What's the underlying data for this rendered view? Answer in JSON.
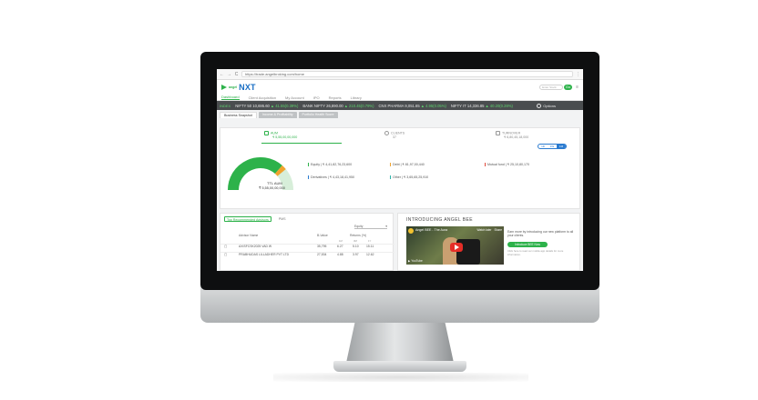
{
  "browser": {
    "url": "https://trade.angelbroking.com/home",
    "back": "←",
    "forward": "→",
    "reload": "C",
    "menu": "⋮"
  },
  "header": {
    "logo_small": "angel",
    "logo_main": "NXT",
    "search_placeholder": "Enter Stock",
    "go": "Go",
    "menu_icon": "≡"
  },
  "nav": {
    "items": [
      "Dashboard",
      "Client Acquisition",
      "My Account",
      "IPO",
      "Reports",
      "Library"
    ]
  },
  "ticker": {
    "category": "INDEX",
    "items": [
      {
        "name": "NIFTY 50",
        "value": "10,695.60",
        "change": "▲ 41.55(0.39%)"
      },
      {
        "name": "BANK NIFTY",
        "value": "26,890.00",
        "change": "▲ 210.45(0.79%)"
      },
      {
        "name": "CNX PHARMA",
        "value": "9,051.65",
        "change": "▲ 4.95(0.05%)"
      },
      {
        "name": "NIFTY IT",
        "value": "14,336.85",
        "change": "▲ 40.20(0.28%)"
      }
    ],
    "settings": "Options"
  },
  "tabs": [
    "Business Snapshot",
    "Income & Profitability",
    "Portfolio Health Score"
  ],
  "panel": {
    "subtabs": [
      {
        "title": "AUM",
        "sub": "₹ 5,55,00,00,000"
      },
      {
        "title": "CLIENTS",
        "sub": "37"
      },
      {
        "title": "TURNOVER",
        "sub": "₹ 6,80,45,18,000"
      }
    ],
    "toggle": [
      "1D",
      "1W",
      "1M"
    ],
    "toggle_active": "1M",
    "gauge_label": "TTL AUM",
    "gauge_value": "₹ 5,55,00,00,000",
    "gauge_fraction": 0.78,
    "metrics": [
      {
        "text": "Equity | ₹ 4,41,82,76,23,600",
        "color": "green"
      },
      {
        "text": "Debt | ₹ 81,97,00,440",
        "color": "orange"
      },
      {
        "text": "Mutual fund | ₹ 25,10,80,170",
        "color": "red"
      },
      {
        "text": "Derivatives | ₹ 4,43,18,41,950",
        "color": "blue"
      },
      {
        "text": "Other | ₹ 3,65,65,25,910",
        "color": "teal"
      }
    ]
  },
  "recommend": {
    "tabs": [
      "Top Recommended Advisors",
      "PMS"
    ],
    "active_tab": "Top Recommended Advisors",
    "select": "Equity",
    "columns": [
      "Advisor Name",
      "B-Value",
      "Returns (%)"
    ],
    "subcolumns": [
      "1M",
      "3M",
      "1Y"
    ],
    "rows": [
      {
        "name": "AXISFCSK2025 VAD W",
        "value": "35,795",
        "r1": "6.27",
        "r2": "5.10",
        "r3": "15.11"
      },
      {
        "name": "PRABHUDAS LILLADHER PVT LTD",
        "value": "27,534",
        "r1": "4.88",
        "r2": "3.97",
        "r3": "12.62"
      }
    ]
  },
  "promo": {
    "title": "INTRODUCING ANGEL BEE",
    "video_title": "Angel BEE - The Aura",
    "video_watch": "Watch later",
    "video_share": "Share",
    "video_brand": "▶ YouTube",
    "text": "Earn more by introducing our new platform to all your clients.",
    "button": "Introduce BEE Now",
    "note": "Click here to read our mobile app details for more information."
  },
  "colors": {
    "green": "#2db24a",
    "blue": "#1a6fc4",
    "ticker_bg": "#4a4d4f"
  }
}
